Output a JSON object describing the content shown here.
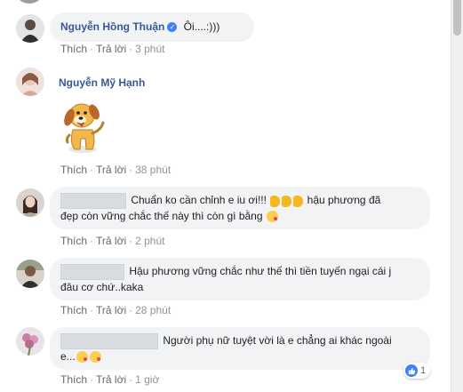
{
  "ui": {
    "like_label": "Thích",
    "reply_label": "Trả lời",
    "separator": "·"
  },
  "comments": [
    {
      "author": "Nguyễn Hồng Thuận",
      "verified": true,
      "text": "Ôi....:)))",
      "time": "3 phút"
    },
    {
      "author": "Nguyễn Mỹ Hạnh",
      "sticker": "dog-sticker",
      "time": "38 phút"
    },
    {
      "text_line1": "Chuẩn ko cần chỉnh e iu ơi!!!",
      "text_line1b": "hậu phương đã",
      "text_line2": "đẹp còn vững chắc thế này thì còn gì bằng",
      "time": "2 phút"
    },
    {
      "text_line1": "Hậu phương vững chắc như thế thì tiền tuyến ngại cái j",
      "text_line2": "đâu cơ chứ..kaka",
      "time": "28 phút"
    },
    {
      "text_line1": "Người phụ nữ tuyệt vời là e chẳng ai khác ngoài",
      "text_line2": "e...",
      "time": "1 giờ",
      "reaction_count": "1",
      "reaction_icon": "like-icon"
    }
  ],
  "colors": {
    "link": "#385898",
    "bubble": "#f2f3f5",
    "meta": "#616770",
    "like_blue": "#4080ff"
  }
}
